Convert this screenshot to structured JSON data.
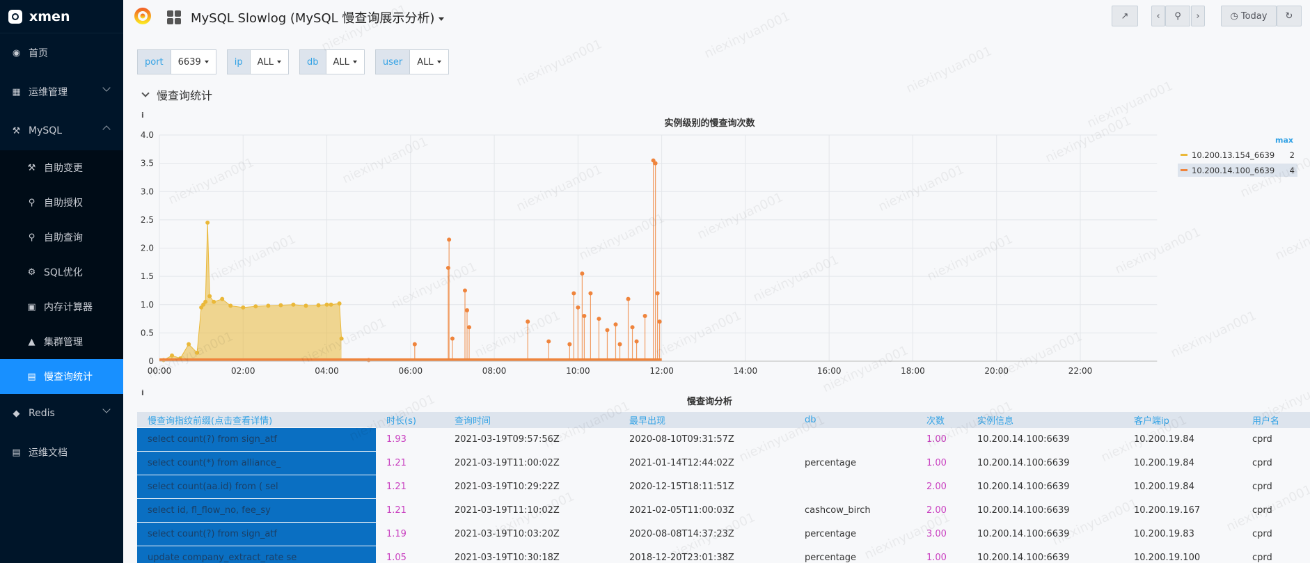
{
  "brand": {
    "name": "xmen"
  },
  "sidebar": {
    "items": [
      {
        "label": "首页",
        "icon": "dashboard-icon"
      },
      {
        "label": "运维管理",
        "icon": "apps-icon"
      },
      {
        "label": "MySQL",
        "icon": "tools-icon"
      },
      {
        "label": "Redis",
        "icon": "database-icon"
      },
      {
        "label": "运维文档",
        "icon": "book-icon"
      }
    ],
    "mysql_sub": [
      {
        "label": "自助变更",
        "icon": "wrench-icon"
      },
      {
        "label": "自助授权",
        "icon": "key-icon"
      },
      {
        "label": "自助查询",
        "icon": "search-icon"
      },
      {
        "label": "SQL优化",
        "icon": "gear-icon"
      },
      {
        "label": "内存计算器",
        "icon": "calculator-icon"
      },
      {
        "label": "集群管理",
        "icon": "cluster-icon"
      },
      {
        "label": "慢查询统计",
        "icon": "file-icon"
      }
    ]
  },
  "header": {
    "title": "MySQL Slowlog (MySQL 慢查询展示分析)",
    "today_label": "Today"
  },
  "variables": [
    {
      "label": "port",
      "value": "6639"
    },
    {
      "label": "ip",
      "value": "ALL"
    },
    {
      "label": "db",
      "value": "ALL"
    },
    {
      "label": "user",
      "value": "ALL"
    }
  ],
  "row_title": "慢查询统计",
  "chart_panel": {
    "info": "i"
  },
  "chart_data": {
    "type": "line",
    "title": "实例级别的慢查询次数",
    "x_ticks": [
      "00:00",
      "02:00",
      "04:00",
      "06:00",
      "08:00",
      "10:00",
      "12:00",
      "14:00",
      "16:00",
      "18:00",
      "20:00",
      "22:00"
    ],
    "ylim": [
      0,
      4.0
    ],
    "y_ticks": [
      "0",
      "0.5",
      "1.0",
      "1.5",
      "2.0",
      "2.5",
      "3.0",
      "3.5",
      "4.0"
    ],
    "grid": true,
    "legend_placement": "right",
    "legend_header": "max",
    "series": [
      {
        "name": "10.200.13.154_6639",
        "color": "#eab839",
        "max": "2",
        "x": [
          0.1,
          0.3,
          0.5,
          0.7,
          0.9,
          1.0,
          1.05,
          1.1,
          1.15,
          1.2,
          1.3,
          1.5,
          1.7,
          2.0,
          2.3,
          2.6,
          2.9,
          3.2,
          3.5,
          3.8,
          4.0,
          4.1,
          4.3,
          4.35
        ],
        "y": [
          0.02,
          0.1,
          0.05,
          0.3,
          0.15,
          0.95,
          1.0,
          1.05,
          2.45,
          1.15,
          1.05,
          1.1,
          0.98,
          0.95,
          0.97,
          0.98,
          0.99,
          1.0,
          0.98,
          0.99,
          1.0,
          1.0,
          1.02,
          0.4
        ]
      },
      {
        "name": "10.200.14.100_6639",
        "color": "#ef843c",
        "max": "4",
        "x": [
          5.0,
          6.1,
          6.9,
          6.92,
          7.0,
          7.3,
          7.35,
          7.4,
          8.8,
          9.3,
          9.8,
          9.9,
          10.0,
          10.1,
          10.15,
          10.3,
          10.5,
          10.7,
          10.9,
          11.0,
          11.2,
          11.3,
          11.4,
          11.6,
          11.8,
          11.85,
          11.9,
          11.95
        ],
        "y": [
          0.02,
          0.3,
          1.65,
          2.15,
          0.4,
          1.25,
          0.9,
          0.6,
          0.7,
          0.35,
          0.3,
          1.2,
          0.95,
          1.55,
          0.8,
          1.2,
          0.75,
          0.55,
          0.65,
          0.3,
          1.1,
          0.6,
          0.35,
          0.8,
          3.55,
          3.5,
          1.2,
          0.7
        ]
      }
    ]
  },
  "table_panel": {
    "info": "i",
    "title": "慢查询分析",
    "columns": [
      "慢查询指纹前缀(点击查看详情)",
      "时长(s)",
      "查询时间",
      "最早出现",
      "db",
      "次数",
      "实例信息",
      "客户端ip",
      "用户名"
    ],
    "rows": [
      [
        "select count(?) from sign_atf",
        "1.93",
        "2021-03-19T09:57:56Z",
        "2020-08-10T09:31:57Z",
        "",
        "1.00",
        "10.200.14.100:6639",
        "10.200.19.84",
        "cprd"
      ],
      [
        "select count(*) from alliance_",
        "1.21",
        "2021-03-19T11:00:02Z",
        "2021-01-14T12:44:02Z",
        "percentage",
        "1.00",
        "10.200.14.100:6639",
        "10.200.19.84",
        "cprd"
      ],
      [
        "select count(aa.id) from ( sel",
        "1.21",
        "2021-03-19T10:29:22Z",
        "2020-12-15T18:11:51Z",
        "",
        "2.00",
        "10.200.14.100:6639",
        "10.200.19.84",
        "cprd"
      ],
      [
        "select id, fl_flow_no, fee_sy",
        "1.21",
        "2021-03-19T11:10:02Z",
        "2021-02-05T11:00:03Z",
        "cashcow_birch",
        "2.00",
        "10.200.14.100:6639",
        "10.200.19.167",
        "cprd"
      ],
      [
        "select count(?) from sign_atf",
        "1.19",
        "2021-03-19T10:03:20Z",
        "2020-08-08T14:37:23Z",
        "percentage",
        "3.00",
        "10.200.14.100:6639",
        "10.200.19.83",
        "cprd"
      ],
      [
        "update company_extract_rate se",
        "1.05",
        "2021-03-19T10:30:18Z",
        "2018-12-20T23:01:38Z",
        "percentage",
        "1.00",
        "10.200.14.100:6639",
        "10.200.19.100",
        "cprd"
      ]
    ]
  },
  "watermark": "niexinyuan001"
}
